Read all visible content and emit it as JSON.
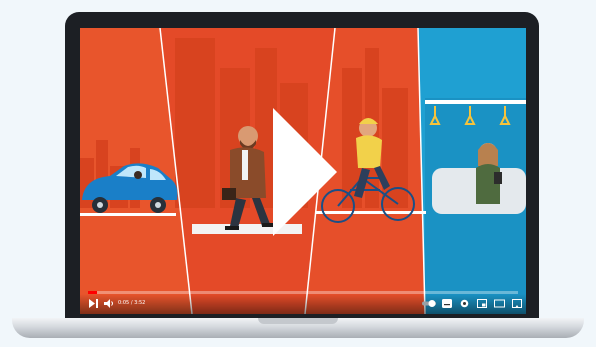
{
  "player": {
    "time_display": "0:05 / 3:52",
    "progress": 0.02,
    "state": "paused",
    "icons": [
      "play-icon",
      "next-icon",
      "volume-icon",
      "autoplay-toggle-icon",
      "captions-icon",
      "settings-icon",
      "miniplayer-icon",
      "theater-icon",
      "cast-icon"
    ]
  },
  "colors": {
    "scene_orange": "#e8552c",
    "scene_blue": "#1fa0d2",
    "progress_red": "#ff0000",
    "bezel": "#1c1f24"
  }
}
